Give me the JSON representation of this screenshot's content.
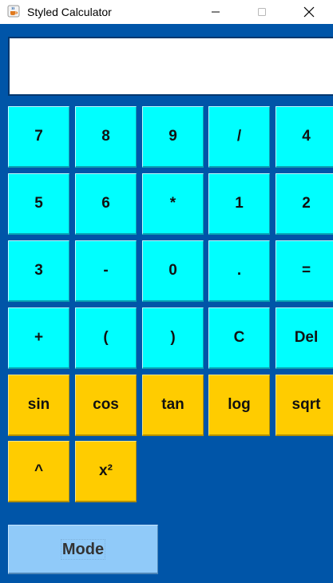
{
  "window": {
    "title": "Styled Calculator",
    "icon": "java-cup-icon"
  },
  "display": {
    "value": ""
  },
  "keys": [
    {
      "label": "7",
      "row": 0,
      "col": 0,
      "color": "cyan"
    },
    {
      "label": "8",
      "row": 0,
      "col": 1,
      "color": "cyan"
    },
    {
      "label": "9",
      "row": 0,
      "col": 2,
      "color": "cyan"
    },
    {
      "label": "/",
      "row": 0,
      "col": 3,
      "color": "cyan"
    },
    {
      "label": "4",
      "row": 0,
      "col": 4,
      "color": "cyan"
    },
    {
      "label": "5",
      "row": 1,
      "col": 0,
      "color": "cyan"
    },
    {
      "label": "6",
      "row": 1,
      "col": 1,
      "color": "cyan"
    },
    {
      "label": "*",
      "row": 1,
      "col": 2,
      "color": "cyan"
    },
    {
      "label": "1",
      "row": 1,
      "col": 3,
      "color": "cyan"
    },
    {
      "label": "2",
      "row": 1,
      "col": 4,
      "color": "cyan"
    },
    {
      "label": "3",
      "row": 2,
      "col": 0,
      "color": "cyan"
    },
    {
      "label": "-",
      "row": 2,
      "col": 1,
      "color": "cyan"
    },
    {
      "label": "0",
      "row": 2,
      "col": 2,
      "color": "cyan"
    },
    {
      "label": ".",
      "row": 2,
      "col": 3,
      "color": "cyan"
    },
    {
      "label": "=",
      "row": 2,
      "col": 4,
      "color": "cyan"
    },
    {
      "label": "+",
      "row": 3,
      "col": 0,
      "color": "cyan"
    },
    {
      "label": "(",
      "row": 3,
      "col": 1,
      "color": "cyan"
    },
    {
      "label": ")",
      "row": 3,
      "col": 2,
      "color": "cyan"
    },
    {
      "label": "C",
      "row": 3,
      "col": 3,
      "color": "cyan"
    },
    {
      "label": "Del",
      "row": 3,
      "col": 4,
      "color": "cyan"
    },
    {
      "label": "sin",
      "row": 4,
      "col": 0,
      "color": "gold"
    },
    {
      "label": "cos",
      "row": 4,
      "col": 1,
      "color": "gold"
    },
    {
      "label": "tan",
      "row": 4,
      "col": 2,
      "color": "gold"
    },
    {
      "label": "log",
      "row": 4,
      "col": 3,
      "color": "gold"
    },
    {
      "label": "sqrt",
      "row": 4,
      "col": 4,
      "color": "gold"
    },
    {
      "label": "^",
      "row": 5,
      "col": 0,
      "color": "gold"
    },
    {
      "label": "x²",
      "row": 5,
      "col": 1,
      "color": "gold"
    }
  ],
  "mode_button": {
    "label": "Mode"
  },
  "colors": {
    "background": "#0055a8",
    "number_key": "#00ffff",
    "function_key": "#ffcc00",
    "mode_button": "#90caf9",
    "key_text": "#111111"
  }
}
